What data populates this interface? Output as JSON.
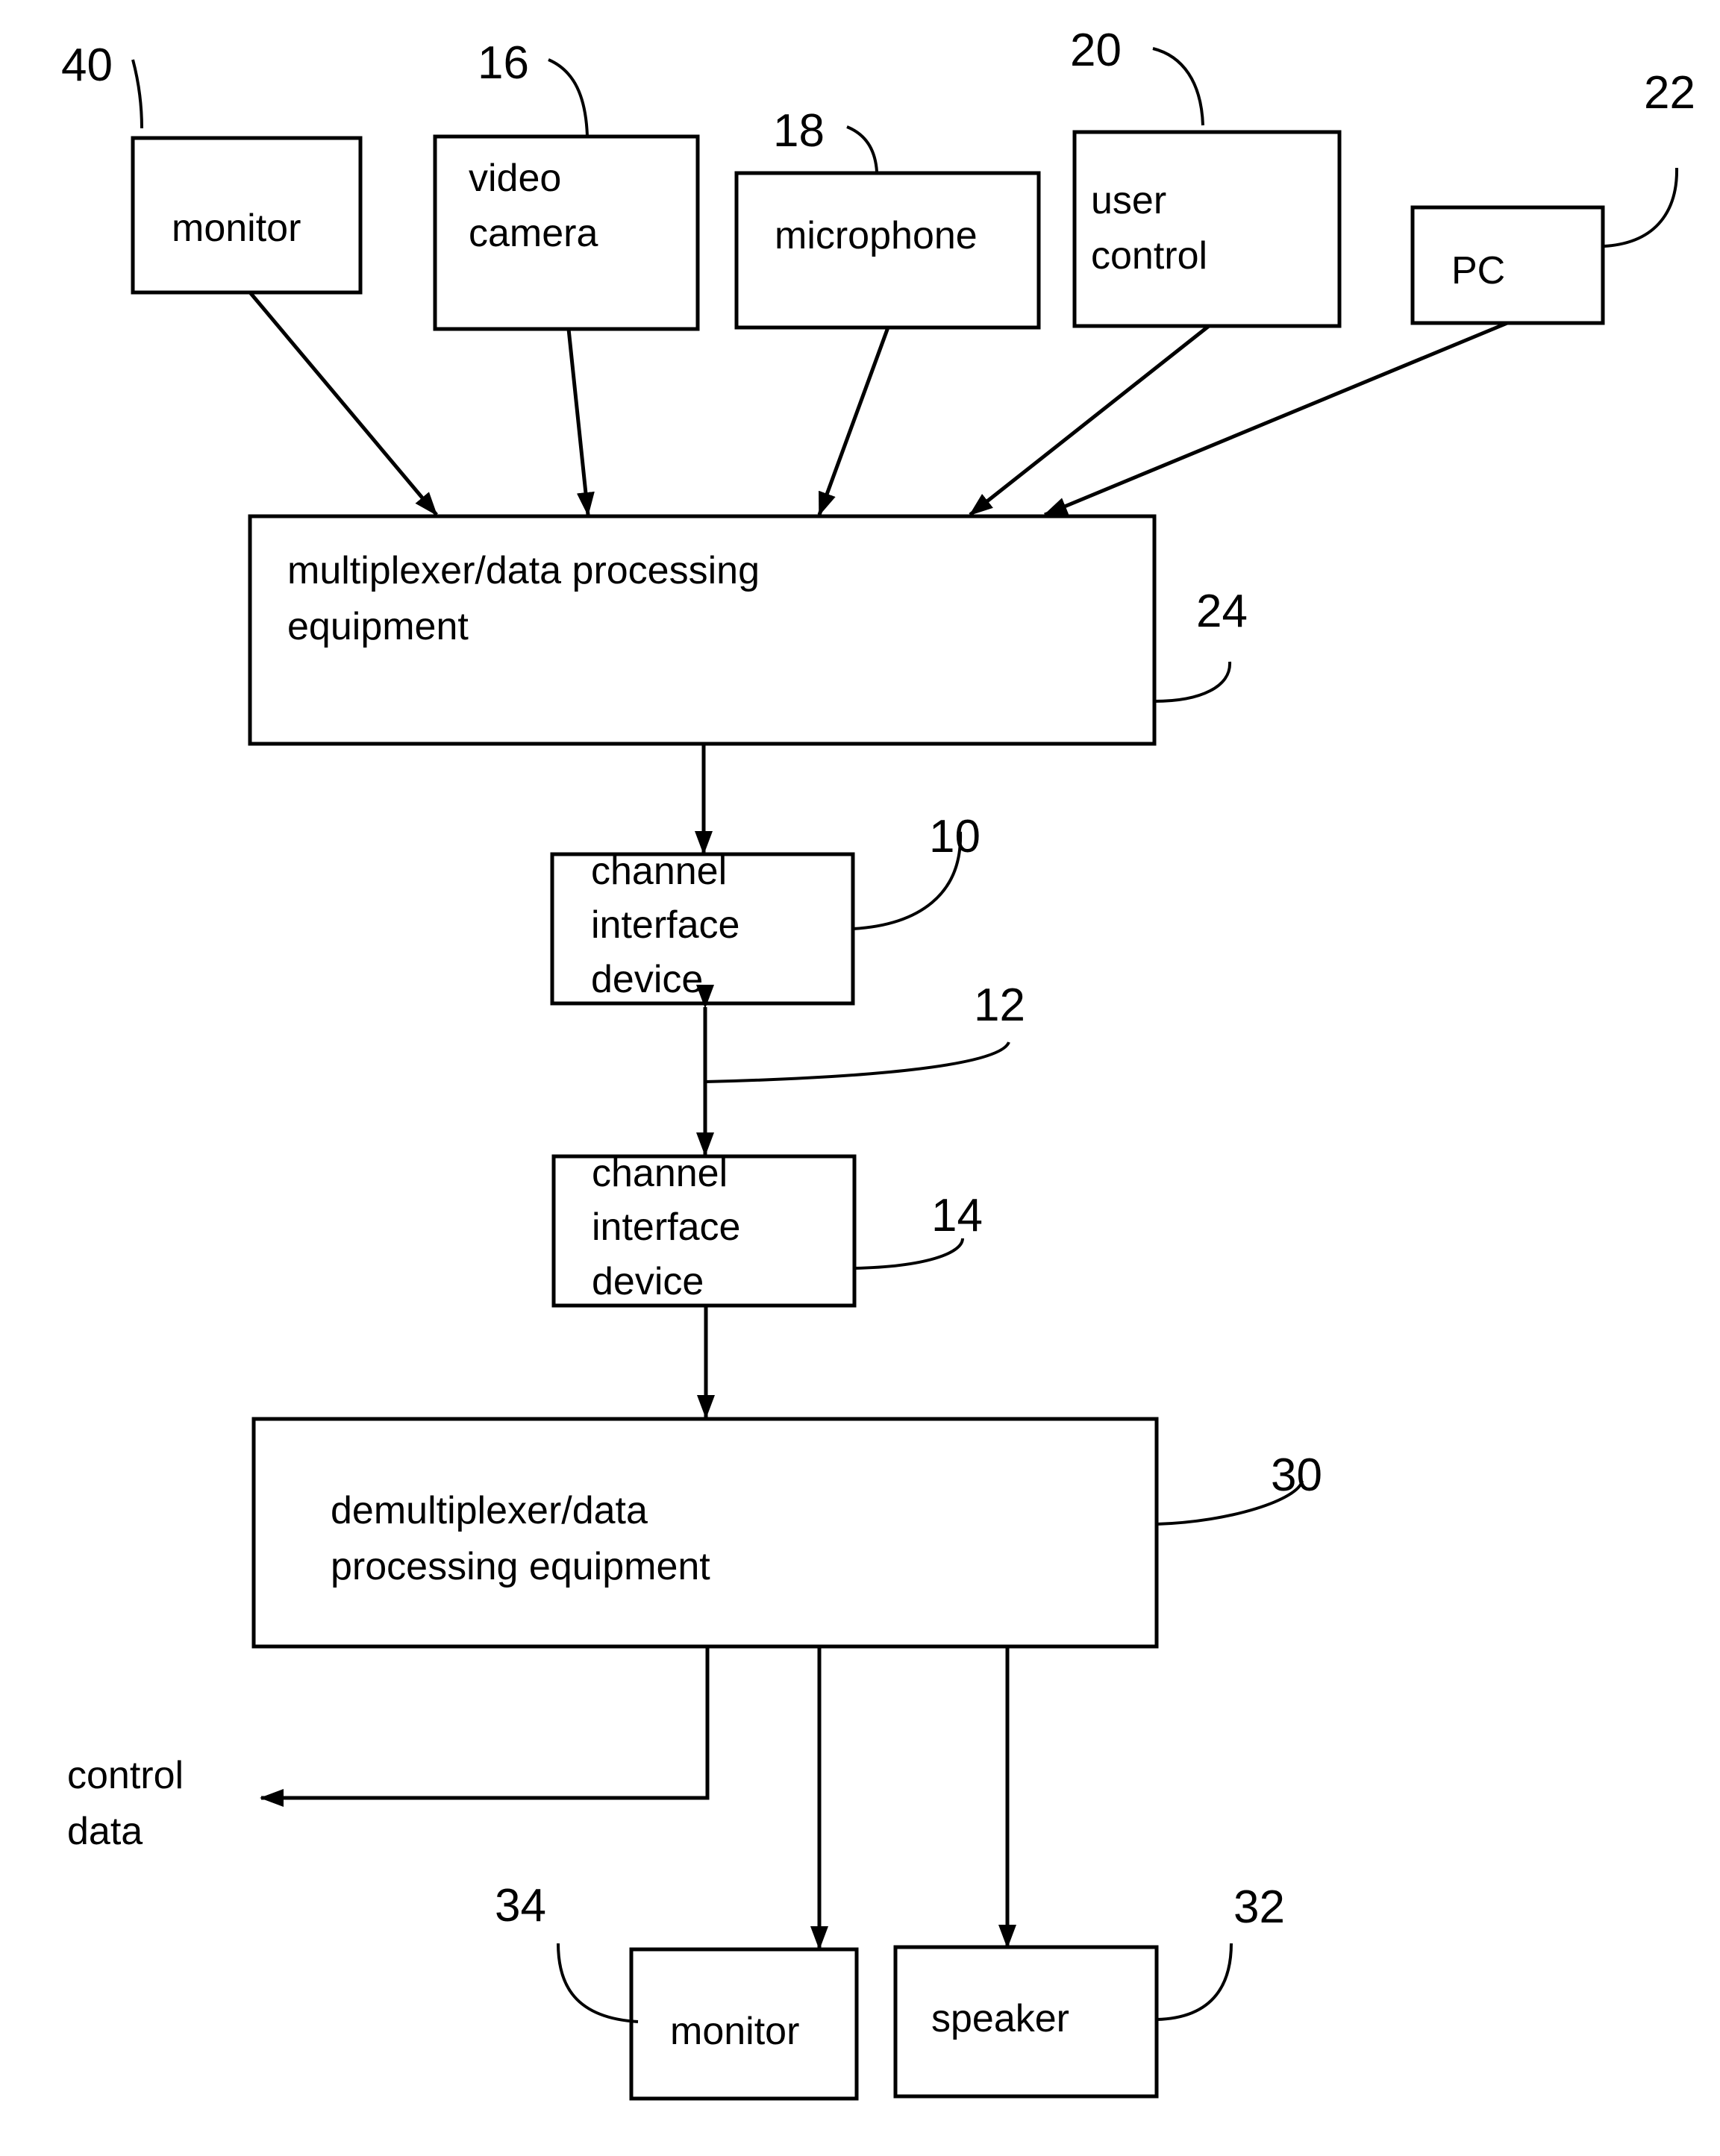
{
  "diagram": {
    "blocks": {
      "monitor_in": {
        "ref": "40",
        "lines": [
          "monitor"
        ]
      },
      "video_camera": {
        "ref": "16",
        "lines": [
          "video",
          "camera"
        ]
      },
      "microphone": {
        "ref": "18",
        "lines": [
          "microphone"
        ]
      },
      "user_control": {
        "ref": "20",
        "lines": [
          "user",
          "control"
        ]
      },
      "pc": {
        "ref": "22",
        "lines": [
          "PC"
        ]
      },
      "multiplexer": {
        "ref": "24",
        "lines": [
          "multiplexer/data processing",
          "equipment"
        ]
      },
      "channel_if_1": {
        "ref": "10",
        "lines": [
          "channel",
          "interface",
          "device"
        ]
      },
      "channel_link": {
        "ref": "12"
      },
      "channel_if_2": {
        "ref": "14",
        "lines": [
          "channel",
          "interface",
          "device"
        ]
      },
      "demultiplexer": {
        "ref": "30",
        "lines": [
          "demultiplexer/data",
          "processing equipment"
        ]
      },
      "monitor_out": {
        "ref": "34",
        "lines": [
          "monitor"
        ]
      },
      "speaker": {
        "ref": "32",
        "lines": [
          "speaker"
        ]
      }
    },
    "outputs": {
      "control_data": {
        "lines": [
          "control",
          "data"
        ]
      }
    }
  }
}
